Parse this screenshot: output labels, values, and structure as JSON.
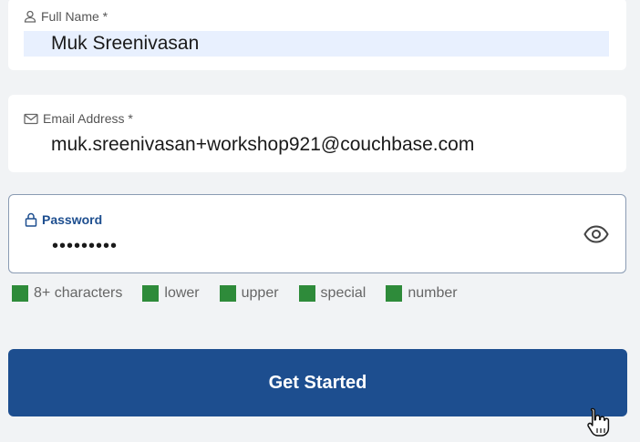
{
  "form": {
    "full_name": {
      "label": "Full Name *",
      "value": "Muk Sreenivasan",
      "icon": "user-icon"
    },
    "email": {
      "label": "Email Address *",
      "value": "muk.sreenivasan+workshop921@couchbase.com",
      "icon": "envelope-icon"
    },
    "password": {
      "label": "Password",
      "value": "•••••••••",
      "icon": "lock-icon",
      "toggle_icon": "eye-icon"
    },
    "requirements": [
      {
        "label": "8+ characters",
        "met": true
      },
      {
        "label": "lower",
        "met": true
      },
      {
        "label": "upper",
        "met": true
      },
      {
        "label": "special",
        "met": true
      },
      {
        "label": "number",
        "met": true
      }
    ],
    "submit_label": "Get Started"
  },
  "colors": {
    "accent": "#1d4e8f",
    "requirement_met": "#2e8b3a",
    "autofill_bg": "#e8f0fe"
  }
}
